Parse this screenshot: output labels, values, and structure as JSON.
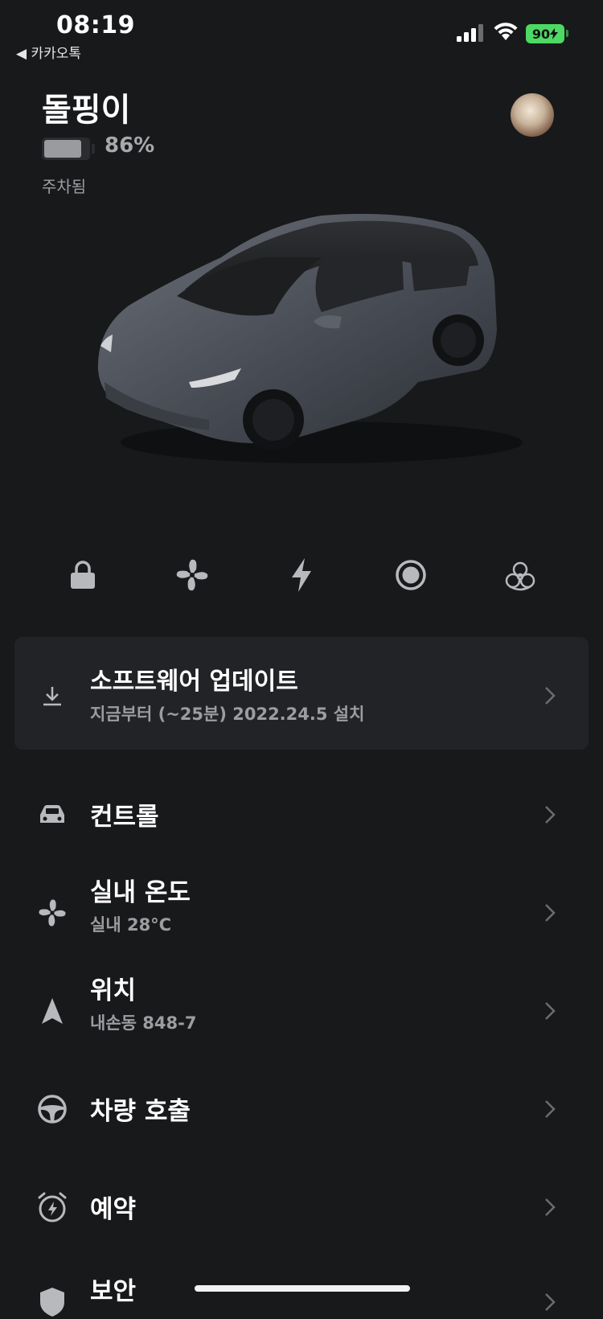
{
  "status_bar": {
    "time": "08:19",
    "back_app": "◀ 카카오톡",
    "battery": "90"
  },
  "vehicle": {
    "name": "돌핑이",
    "battery_percent_label": "86%",
    "battery_level": 0.86,
    "state": "주차됨"
  },
  "quick_controls": [
    "lock-icon",
    "fan-icon",
    "bolt-icon",
    "sentry-icon",
    "bioweapon-icon"
  ],
  "update": {
    "title": "소프트웨어 업데이트",
    "subtitle": "지금부터 (~25분) 2022.24.5 설치"
  },
  "menu": [
    {
      "title": "컨트롤",
      "subtitle": ""
    },
    {
      "title": "실내 온도",
      "subtitle": "실내 28°C"
    },
    {
      "title": "위치",
      "subtitle": "내손동 848-7"
    },
    {
      "title": "차량 호출",
      "subtitle": ""
    },
    {
      "title": "예약",
      "subtitle": ""
    },
    {
      "title": "보안",
      "subtitle": ""
    }
  ],
  "colors": {
    "background": "#18191b",
    "card": "#222326",
    "muted": "#9c9da1",
    "icon": "#b8b9bd",
    "battery_green": "#4cd964"
  }
}
